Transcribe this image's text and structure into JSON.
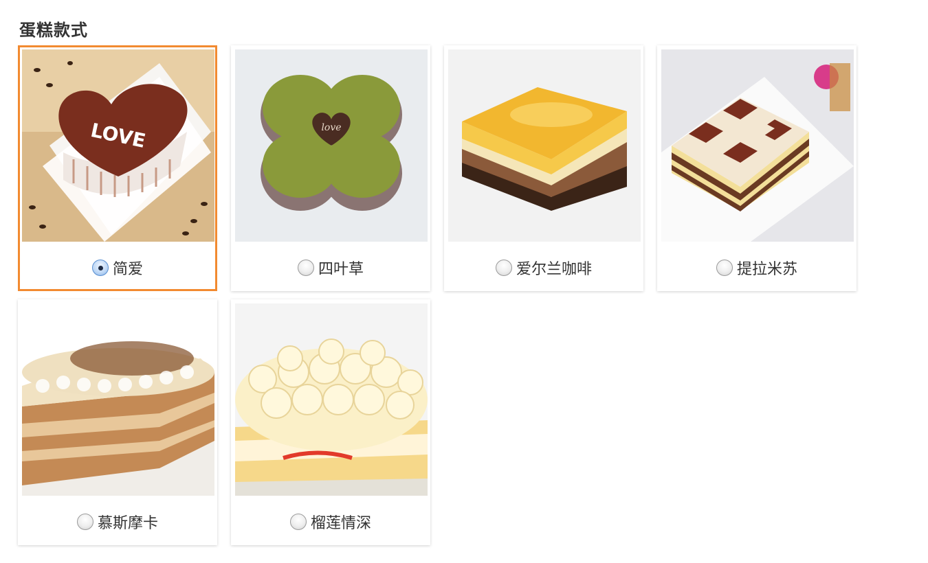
{
  "section_title": "蛋糕款式",
  "accent_color": "#f28a30",
  "cakes": [
    {
      "name": "简爱",
      "selected": true
    },
    {
      "name": "四叶草",
      "selected": false
    },
    {
      "name": "爱尔兰咖啡",
      "selected": false
    },
    {
      "name": "提拉米苏",
      "selected": false
    },
    {
      "name": "慕斯摩卡",
      "selected": false
    },
    {
      "name": "榴莲情深",
      "selected": false
    }
  ]
}
